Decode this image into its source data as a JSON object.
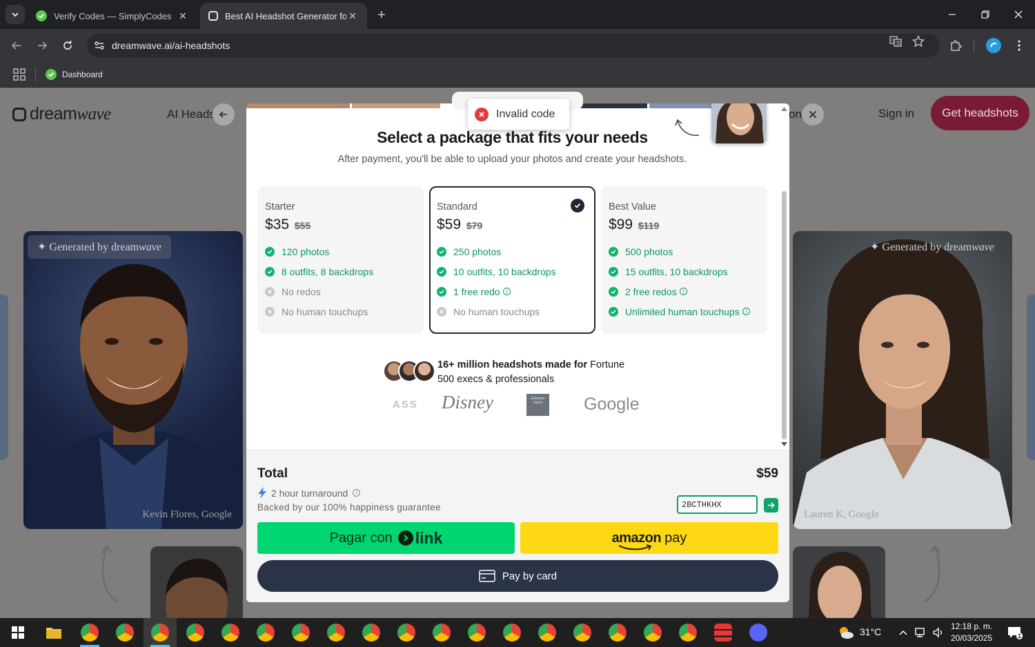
{
  "browser": {
    "tabs": [
      {
        "title": "Verify Codes — SimplyCodes",
        "active": false
      },
      {
        "title": "Best AI Headshot Generator for",
        "active": true
      }
    ],
    "url": "dreamwave.ai/ai-headshots",
    "bookmarks": [
      {
        "label": "Dashboard"
      }
    ]
  },
  "site": {
    "logo_prefix": "dream",
    "logo_suffix": "wave",
    "nav_link": "AI Heads",
    "nav_fragment": "on",
    "signin": "Sign in",
    "cta": "Get headshots",
    "left_card": {
      "badge_prefix": "Generated by dream",
      "badge_suffix": "wave",
      "caption": "Kevin Flores, Google"
    },
    "right_card": {
      "badge_prefix": "Generated by dream",
      "badge_suffix": "wave",
      "caption": "Lauren K, Google"
    }
  },
  "modal": {
    "headline": "Select a package that fits your needs",
    "subhead": "After payment, you'll be able to upload your photos and create your headshots.",
    "packages": [
      {
        "name": "Starter",
        "price": "$35",
        "old_price": "$55",
        "selected": false,
        "features": [
          {
            "text": "120 photos",
            "included": true
          },
          {
            "text": "8 outfits, 8 backdrops",
            "included": true
          },
          {
            "text": "No redos",
            "included": false
          },
          {
            "text": "No human touchups",
            "included": false
          }
        ]
      },
      {
        "name": "Standard",
        "price": "$59",
        "old_price": "$79",
        "selected": true,
        "features": [
          {
            "text": "250 photos",
            "included": true
          },
          {
            "text": "10 outfits, 10 backdrops",
            "included": true
          },
          {
            "text": "1 free redo",
            "included": true,
            "info": true
          },
          {
            "text": "No human touchups",
            "included": false
          }
        ]
      },
      {
        "name": "Best Value",
        "price": "$99",
        "old_price": "$119",
        "selected": false,
        "features": [
          {
            "text": "500 photos",
            "included": true
          },
          {
            "text": "15 outfits, 10 backdrops",
            "included": true
          },
          {
            "text": "2 free redos",
            "included": true,
            "info": true
          },
          {
            "text": "Unlimited human touchups",
            "included": true,
            "info": true
          }
        ]
      }
    ],
    "social_proof": {
      "bold": "16+ million headshots made for",
      "rest_line1": " Fortune",
      "line2": "500 execs & professionals"
    },
    "brands": [
      "ASS",
      "Disney",
      "Goldman Sachs",
      "Google"
    ],
    "checkout": {
      "total_label": "Total",
      "total_value": "$59",
      "turnaround": "2 hour turnaround",
      "guarantee": "Backed by our 100% happiness guarantee",
      "promo_value": "2BCTHKHX",
      "pay_link_prefix": "Pagar con",
      "pay_link_word": "link",
      "amazon_word": "amazon",
      "amazon_pay": "pay",
      "pay_card": "Pay by card"
    }
  },
  "toast": {
    "message": "Invalid code"
  },
  "taskbar": {
    "temperature": "31°C",
    "time": "12:18 p. m.",
    "date": "20/03/2025",
    "notifications": "1"
  },
  "colors": {
    "accent_cta": "#7a1b36",
    "check_green": "#12b36d",
    "link_green": "#00d66f",
    "amazon_yellow": "#ffd814",
    "card_navy": "#2a3446",
    "error_red": "#e03a3a"
  }
}
